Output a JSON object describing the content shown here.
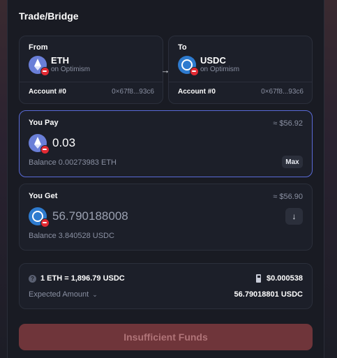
{
  "title": "Trade/Bridge",
  "from": {
    "label": "From",
    "symbol": "ETH",
    "network": "on Optimism",
    "account": "Account #0",
    "address": "0×67f8...93c6"
  },
  "to": {
    "label": "To",
    "symbol": "USDC",
    "network": "on Optimism",
    "account": "Account #0",
    "address": "0×67f8...93c6"
  },
  "pay": {
    "label": "You Pay",
    "usd_value": "≈ $56.92",
    "amount": "0.03",
    "balance": "Balance 0.00273983 ETH",
    "max_label": "Max"
  },
  "get": {
    "label": "You Get",
    "usd_value": "≈ $56.90",
    "amount": "56.790188008",
    "balance": "Balance 3.840528 USDC"
  },
  "info": {
    "rate": "1 ETH = 1,896.79 USDC",
    "gas": "$0.000538",
    "expected_label": "Expected Amount",
    "expected_value": "56.79018801 USDC"
  },
  "submit_label": "Insufficient Funds",
  "icons": {
    "eth": "ethereum-icon",
    "usdc": "usdc-icon",
    "network_badge": "optimism-badge-icon",
    "swap": "arrow-right-icon",
    "down": "arrow-down-icon",
    "help": "question-icon",
    "gas": "fuel-pump-icon",
    "chevron": "chevron-down-icon"
  },
  "colors": {
    "accent_border": "#5a6bd8",
    "danger_button": "#6f353a",
    "optimism_red": "#e22a33"
  }
}
